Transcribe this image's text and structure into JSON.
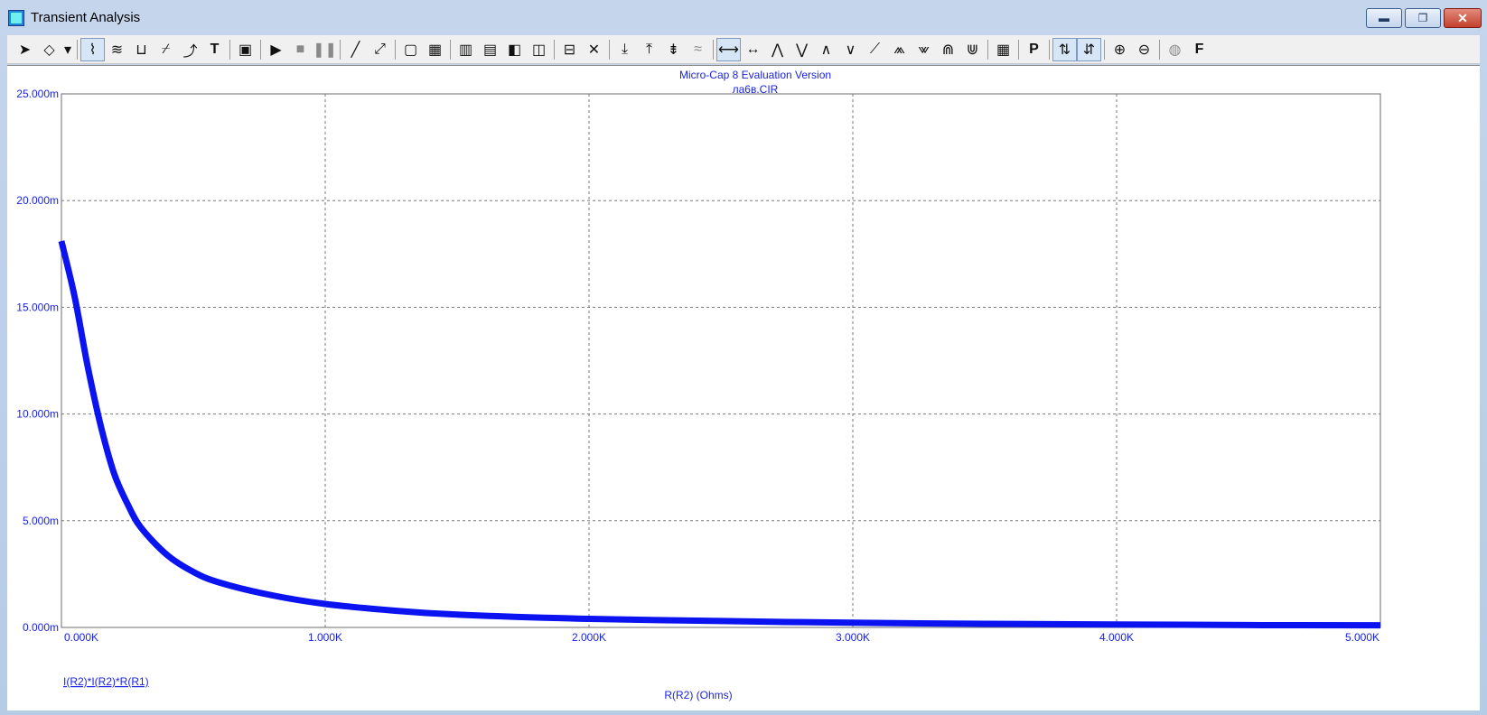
{
  "window": {
    "title": "Transient Analysis",
    "controls": {
      "minimize": "▬",
      "maximize": "❐",
      "close": "✕"
    }
  },
  "toolbar": {
    "groups": [
      [
        "select-arrow-icon",
        "component-icon",
        "dropdown-arrow-icon"
      ],
      [
        "graph-icon",
        "wave-icon",
        "bracket-icon",
        "scale-icon",
        "node-icon",
        "text-T-icon"
      ],
      [
        "properties-icon"
      ],
      [
        "run-icon",
        "stop-icon",
        "pause-icon"
      ],
      [
        "line-icon",
        "diagonal-icon"
      ],
      [
        "frame-icon",
        "grid-icon"
      ],
      [
        "vgrid-icon",
        "hgrid-icon",
        "leftgrid-icon",
        "splitgrid-icon"
      ],
      [
        "horiz-icon",
        "cross-icon"
      ],
      [
        "cursor1-icon",
        "cursor2-icon",
        "cursor3-icon",
        "cursor4-icon"
      ],
      [
        "peak-lr-icon",
        "valley-lr-icon",
        "peak-icon",
        "valley-icon",
        "high-icon",
        "low-icon",
        "inflect-icon",
        "global-high-icon",
        "global-low-icon",
        "top-icon",
        "bottom-icon"
      ],
      [
        "table-icon"
      ],
      [
        "P-label-icon"
      ],
      [
        "x-scale-icon",
        "y-scale-icon"
      ],
      [
        "zoom-in-icon",
        "zoom-out-icon"
      ],
      [
        "color-icon",
        "font-F-icon"
      ]
    ]
  },
  "plot": {
    "header_line1": "Micro-Cap 8 Evaluation Version",
    "header_line2": "ла6в.CIR",
    "expression_label": "I(R2)*I(R2)*R(R1)",
    "x_axis_label": "R(R2) (Ohms)"
  },
  "chart_data": {
    "type": "line",
    "title": "Micro-Cap 8 Evaluation Version",
    "subtitle": "ла6в.CIR",
    "xlabel": "R(R2) (Ohms)",
    "ylabel": "",
    "xlim": [
      0,
      5000
    ],
    "ylim": [
      0,
      0.025
    ],
    "x_ticks": [
      "0.000K",
      "1.000K",
      "2.000K",
      "3.000K",
      "4.000K",
      "5.000K"
    ],
    "y_ticks": [
      "0.000m",
      "5.000m",
      "10.000m",
      "15.000m",
      "20.000m",
      "25.000m"
    ],
    "grid": true,
    "line_color": "#0b14f0",
    "series": [
      {
        "name": "I(R2)*I(R2)*R(R1)",
        "x": [
          0,
          50,
          100,
          150,
          200,
          250,
          300,
          400,
          500,
          600,
          800,
          1000,
          1250,
          1500,
          2000,
          2500,
          3000,
          3500,
          4000,
          4500,
          5000
        ],
        "y": [
          0.0181,
          0.0155,
          0.0122,
          0.0094,
          0.0072,
          0.0058,
          0.0047,
          0.0034,
          0.0026,
          0.0021,
          0.0015,
          0.0011,
          0.0008,
          0.0006,
          0.0004,
          0.0003,
          0.00022,
          0.00017,
          0.00014,
          0.00011,
          0.0001
        ]
      }
    ]
  }
}
